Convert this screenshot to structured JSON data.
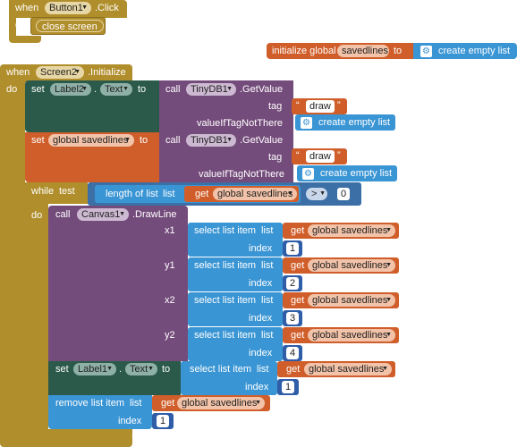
{
  "event1": {
    "when": "when",
    "component": "Button1",
    "event": ".Click",
    "do": "do",
    "action": "close screen"
  },
  "global_init": {
    "label": "initialize global",
    "name": "savedlines",
    "to": "to",
    "value": "create empty list"
  },
  "event2": {
    "when": "when",
    "component": "Screen2",
    "event": ".Initialize",
    "do": "do"
  },
  "set1": {
    "set": "set",
    "component": "Label2",
    "dot": ".",
    "property": "Text",
    "to": "to",
    "call": "call",
    "db": "TinyDB1",
    "method": ".GetValue",
    "tag_label": "tag",
    "tag_value": "draw",
    "value_if_label": "valueIfTagNotThere",
    "value_if": "create empty list"
  },
  "set2": {
    "set": "set",
    "variable": "global savedlines",
    "to": "to",
    "call": "call",
    "db": "TinyDB1",
    "method": ".GetValue",
    "tag_label": "tag",
    "tag_value": "draw",
    "value_if_label": "valueIfTagNotThere",
    "value_if": "create empty list"
  },
  "while": {
    "label": "while",
    "test": "test",
    "length_label": "length of list",
    "list_label": "list",
    "get": "get",
    "var": "global savedlines",
    "op": ">",
    "compare": "0",
    "do": "do"
  },
  "drawline": {
    "call": "call",
    "component": "Canvas1",
    "method": ".DrawLine",
    "args": [
      {
        "name": "x1",
        "select": "select list item",
        "list": "list",
        "get": "get",
        "var": "global savedlines",
        "index_label": "index",
        "index": "1"
      },
      {
        "name": "y1",
        "select": "select list item",
        "list": "list",
        "get": "get",
        "var": "global savedlines",
        "index_label": "index",
        "index": "2"
      },
      {
        "name": "x2",
        "select": "select list item",
        "list": "list",
        "get": "get",
        "var": "global savedlines",
        "index_label": "index",
        "index": "3"
      },
      {
        "name": "y2",
        "select": "select list item",
        "list": "list",
        "get": "get",
        "var": "global savedlines",
        "index_label": "index",
        "index": "4"
      }
    ]
  },
  "set3": {
    "set": "set",
    "component": "Label1",
    "dot": ".",
    "property": "Text",
    "to": "to",
    "select": "select list item",
    "list": "list",
    "get": "get",
    "var": "global savedlines",
    "index_label": "index",
    "index": "1"
  },
  "remove": {
    "label": "remove list item",
    "list": "list",
    "get": "get",
    "var": "global savedlines",
    "index_label": "index",
    "index": "1"
  }
}
